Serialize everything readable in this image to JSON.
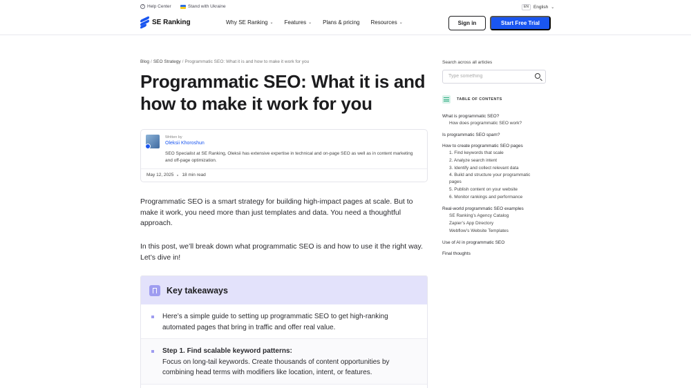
{
  "topbar": {
    "help_center": "Help Center",
    "ukraine": "Stand with Ukraine",
    "lang_code": "EN",
    "lang_label": "English"
  },
  "header": {
    "logo": "SE Ranking",
    "nav": [
      "Why SE Ranking",
      "Features",
      "Plans & pricing",
      "Resources"
    ],
    "sign_in": "Sign in",
    "trial": "Start Free Trial"
  },
  "breadcrumb": {
    "blog": "Blog",
    "category": "SEO Strategy",
    "current": "Programmatic SEO: What it is and how to make it work for you"
  },
  "article": {
    "title": "Programmatic SEO: What it is and how to make it work for you",
    "written_by": "Written by",
    "author": "Oleksii Khoroshun",
    "bio": "SEO Specialist at SE Ranking, Oleksii has extensive expertise in technical and on-page SEO as well as in content marketing and off-page optimization.",
    "date": "May 12, 2025",
    "read_time": "18 min read",
    "p1": "Programmatic SEO is a smart strategy for building high-impact pages at scale. But to make it work, you need more than just templates and data. You need a thoughtful approach.",
    "p2": "In this post, we’ll break down what programmatic SEO is and how to use it the right way. Let’s dive in!"
  },
  "takeaways": {
    "title": "Key takeaways",
    "intro": "Here’s a simple guide to setting up programmatic SEO to get high-ranking automated pages that bring in traffic and offer real value.",
    "step1_title": "Step 1. Find scalable keyword patterns:",
    "step1_text": "Focus on long-tail keywords. Create thousands of content opportunities by combining head terms with modifiers like location, intent, or features."
  },
  "sidebar": {
    "search_label": "Search across all articles",
    "search_placeholder": "Type something",
    "toc_title": "TABLE OF CONTENTS",
    "toc": [
      {
        "label": "What is programmatic SEO?",
        "children": [
          "How does programmatic SEO work?"
        ]
      },
      {
        "label": "Is programmatic SEO spam?",
        "children": []
      },
      {
        "label": "How to create programmatic SEO pages",
        "children": [
          "1. Find keywords that scale",
          "2. Analyze search intent",
          "3. Identify and collect relevant data",
          "4. Build and structure your programmatic pages",
          "5. Publish content on your website",
          "6. Monitor rankings and performance"
        ]
      },
      {
        "label": "Real-world programmatic SEO examples",
        "children": [
          "SE Ranking’s Agency Catalog",
          "Zapier’s App Directory",
          "Webflow’s Website Templates"
        ]
      },
      {
        "label": "Use of AI in programmatic SEO",
        "children": []
      },
      {
        "label": "Final thoughts",
        "children": []
      }
    ]
  },
  "colors": {
    "brand_blue": "#1a56f0",
    "takeaway_header": "#e3e2fb",
    "toc_icon": "#2fae82"
  }
}
